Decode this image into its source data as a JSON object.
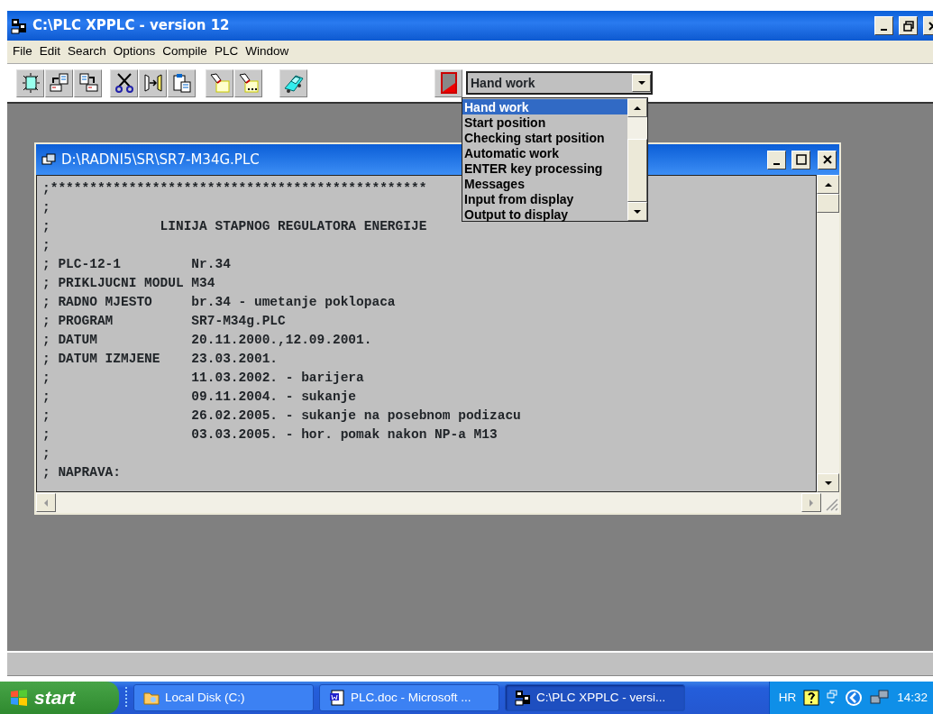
{
  "window": {
    "title": "C:\\PLC XPPLC - version 12"
  },
  "menu": [
    "File",
    "Edit",
    "Search",
    "Options",
    "Compile",
    "PLC",
    "Window"
  ],
  "mode_combo": {
    "value": "Hand work",
    "expanded": true,
    "options": [
      {
        "label": "Hand work",
        "selected": true
      },
      {
        "label": "Start position",
        "selected": false
      },
      {
        "label": "Checking start position",
        "selected": false
      },
      {
        "label": "Automatic work",
        "selected": false
      },
      {
        "label": "ENTER key processing",
        "selected": false
      },
      {
        "label": "Messages",
        "selected": false
      },
      {
        "label": "Input from display",
        "selected": false
      },
      {
        "label": "Output to display",
        "selected": false
      }
    ]
  },
  "document_window": {
    "title": "D:\\RADNI5\\SR\\SR7-M34G.PLC",
    "lines": [
      ";************************************************",
      ";",
      ";              LINIJA STAPNOG REGULATORA ENERGIJE",
      ";",
      "; PLC-12-1         Nr.34",
      "; PRIKLJUCNI MODUL M34",
      "; RADNO MJESTO     br.34 - umetanje poklopaca",
      "; PROGRAM          SR7-M34g.PLC",
      "; DATUM            20.11.2000.,12.09.2001.",
      "; DATUM IZMJENE    23.03.2001.",
      ";                  11.03.2002. - barijera",
      ";                  09.11.2004. - sukanje",
      ";                  26.02.2005. - sukanje na posebnom podizacu",
      ";                  03.03.2005. - hor. pomak nakon NP-a M13",
      ";",
      "; NAPRAVA:"
    ]
  },
  "taskbar": {
    "start": "start",
    "tasks": [
      {
        "label": "Local Disk (C:)",
        "kind": "folder",
        "selected": false
      },
      {
        "label": "PLC.doc - Microsoft ...",
        "kind": "document",
        "selected": false
      },
      {
        "label": "C:\\PLC XPPLC - versi...",
        "kind": "app",
        "selected": true
      }
    ],
    "language": "HR",
    "time": "14:32"
  }
}
